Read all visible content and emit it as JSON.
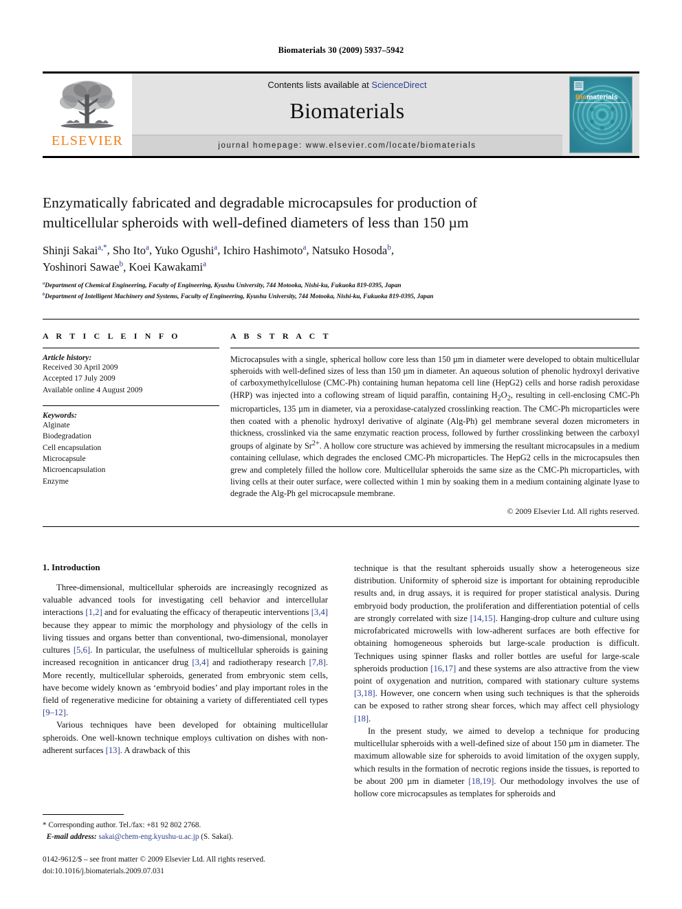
{
  "running_head": "Biomaterials 30 (2009) 5937–5942",
  "masthead": {
    "contents_prefix": "Contents lists available at ",
    "sciencedirect": "ScienceDirect",
    "journal_name": "Biomaterials",
    "homepage": "journal homepage: www.elsevier.com/locate/biomaterials",
    "publisher_wordmark": "ELSEVIER",
    "publisher_color": "#f07f1a",
    "cover_title": "Biomaterials",
    "cover_accent": "#f0a030",
    "cover_bg": "#2f9aa8"
  },
  "title": {
    "line1": "Enzymatically fabricated and degradable microcapsules for production of",
    "line2": "multicellular spheroids with well-defined diameters of less than 150 µm"
  },
  "authors": {
    "line1": "Shinji Sakai",
    "line1_sup": "a,*",
    "list": "Shinji Sakai a,*, Sho Ito a, Yuko Ogushi a, Ichiro Hashimoto a, Natsuko Hosoda b, Yoshinori Sawae b, Koei Kawakami a"
  },
  "affiliations": [
    {
      "marker": "a",
      "text": "Department of Chemical Engineering, Faculty of Engineering, Kyushu University, 744 Motooka, Nishi-ku, Fukuoka 819-0395, Japan"
    },
    {
      "marker": "b",
      "text": "Department of Intelligent Machinery and Systems, Faculty of Engineering, Kyushu University, 744 Motooka, Nishi-ku, Fukuoka 819-0395, Japan"
    }
  ],
  "article_info": {
    "heading": "A R T I C L E   I N F O",
    "history_label": "Article history:",
    "history": [
      "Received 30 April 2009",
      "Accepted 17 July 2009",
      "Available online 4 August 2009"
    ],
    "keywords_label": "Keywords:",
    "keywords": [
      "Alginate",
      "Biodegradation",
      "Cell encapsulation",
      "Microcapsule",
      "Microencapsulation",
      "Enzyme"
    ]
  },
  "abstract": {
    "heading": "A B S T R A C T",
    "text": "Microcapsules with a single, spherical hollow core less than 150 µm in diameter were developed to obtain multicellular spheroids with well-defined sizes of less than 150 µm in diameter. An aqueous solution of phenolic hydroxyl derivative of carboxymethylcellulose (CMC-Ph) containing human hepatoma cell line (HepG2) cells and horse radish peroxidase (HRP) was injected into a coflowing stream of liquid paraffin, containing H2O2, resulting in cell-enclosing CMC-Ph microparticles, 135 µm in diameter, via a peroxidase-catalyzed crosslinking reaction. The CMC-Ph microparticles were then coated with a phenolic hydroxyl derivative of alginate (Alg-Ph) gel membrane several dozen micrometers in thickness, crosslinked via the same enzymatic reaction process, followed by further crosslinking between the carboxyl groups of alginate by Sr2+. A hollow core structure was achieved by immersing the resultant microcapsules in a medium containing cellulase, which degrades the enclosed CMC-Ph microparticles. The HepG2 cells in the microcapsules then grew and completely filled the hollow core. Multicellular spheroids the same size as the CMC-Ph microparticles, with living cells at their outer surface, were collected within 1 min by soaking them in a medium containing alginate lyase to degrade the Alg-Ph gel microcapsule membrane.",
    "copyright": "© 2009 Elsevier Ltd. All rights reserved."
  },
  "introduction": {
    "section_number_title": "1.  Introduction",
    "left_p1": "Three-dimensional, multicellular spheroids are increasingly recognized as valuable advanced tools for investigating cell behavior and intercellular interactions [1,2] and for evaluating the efficacy of therapeutic interventions [3,4] because they appear to mimic the morphology and physiology of the cells in living tissues and organs better than conventional, two-dimensional, monolayer cultures [5,6]. In particular, the usefulness of multicellular spheroids is gaining increased recognition in anticancer drug [3,4] and radiotherapy research [7,8]. More recently, multicellular spheroids, generated from embryonic stem cells, have become widely known as 'embryoid bodies' and play important roles in the field of regenerative medicine for obtaining a variety of differentiated cell types [9–12].",
    "left_p2": "Various techniques have been developed for obtaining multicellular spheroids. One well-known technique employs cultivation on dishes with non-adherent surfaces [13]. A drawback of this",
    "right_p1": "technique is that the resultant spheroids usually show a heterogeneous size distribution. Uniformity of spheroid size is important for obtaining reproducible results and, in drug assays, it is required for proper statistical analysis. During embryoid body production, the proliferation and differentiation potential of cells are strongly correlated with size [14,15]. Hanging-drop culture and culture using microfabricated microwells with low-adherent surfaces are both effective for obtaining homogeneous spheroids but large-scale production is difficult. Techniques using spinner flasks and roller bottles are useful for large-scale spheroids production [16,17] and these systems are also attractive from the view point of oxygenation and nutrition, compared with stationary culture systems [3,18]. However, one concern when using such techniques is that the spheroids can be exposed to rather strong shear forces, which may affect cell physiology [18].",
    "right_p2": "In the present study, we aimed to develop a technique for producing multicellular spheroids with a well-defined size of about 150 µm in diameter. The maximum allowable size for spheroids to avoid limitation of the oxygen supply, which results in the formation of necrotic regions inside the tissues, is reported to be about 200 µm in diameter [18,19]. Our methodology involves the use of hollow core microcapsules as templates for spheroids and"
  },
  "footnote": {
    "corresponding": "* Corresponding author. Tel./fax: +81 92 802 2768.",
    "email_label": "E-mail address:",
    "email": "sakai@chem-eng.kyushu-u.ac.jp",
    "email_suffix": "(S. Sakai)."
  },
  "page_footer": {
    "line1": "0142-9612/$ – see front matter © 2009 Elsevier Ltd. All rights reserved.",
    "line2": "doi:10.1016/j.biomaterials.2009.07.031"
  },
  "colors": {
    "link": "#2a3d8f",
    "elsevier_orange": "#f07f1a",
    "masthead_grey": "#e3e3e3",
    "homepage_grey": "#d2d2d2"
  }
}
